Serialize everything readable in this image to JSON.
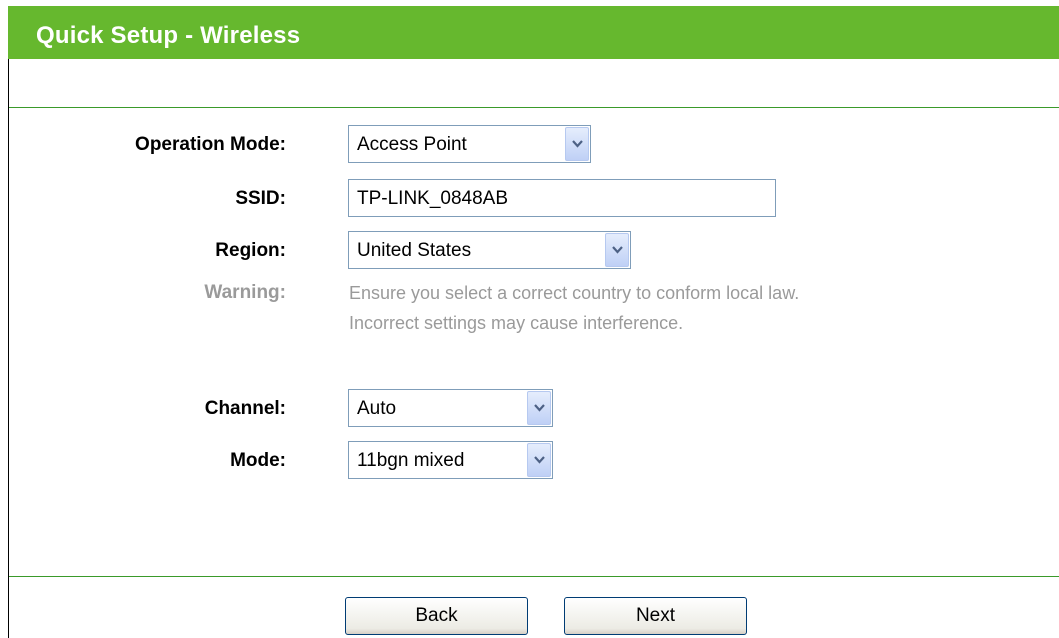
{
  "header": {
    "title": "Quick Setup - Wireless"
  },
  "form": {
    "operation_mode": {
      "label": "Operation Mode:",
      "value": "Access Point"
    },
    "ssid": {
      "label": "SSID:",
      "value": "TP-LINK_0848AB"
    },
    "region": {
      "label": "Region:",
      "value": "United States"
    },
    "warning": {
      "label": "Warning:",
      "line1": "Ensure you select a correct country to conform local law.",
      "line2": "Incorrect settings may cause interference."
    },
    "channel": {
      "label": "Channel:",
      "value": "Auto"
    },
    "mode": {
      "label": "Mode:",
      "value": "11bgn mixed"
    }
  },
  "buttons": {
    "back_label": "Back",
    "next_label": "Next"
  },
  "colors": {
    "header_green": "#66b82e",
    "divider_green": "#3a9a2a",
    "muted_text": "#9a9a9a",
    "input_border": "#7f9db9"
  },
  "icons": {
    "dropdown": "chevron-down-icon"
  }
}
